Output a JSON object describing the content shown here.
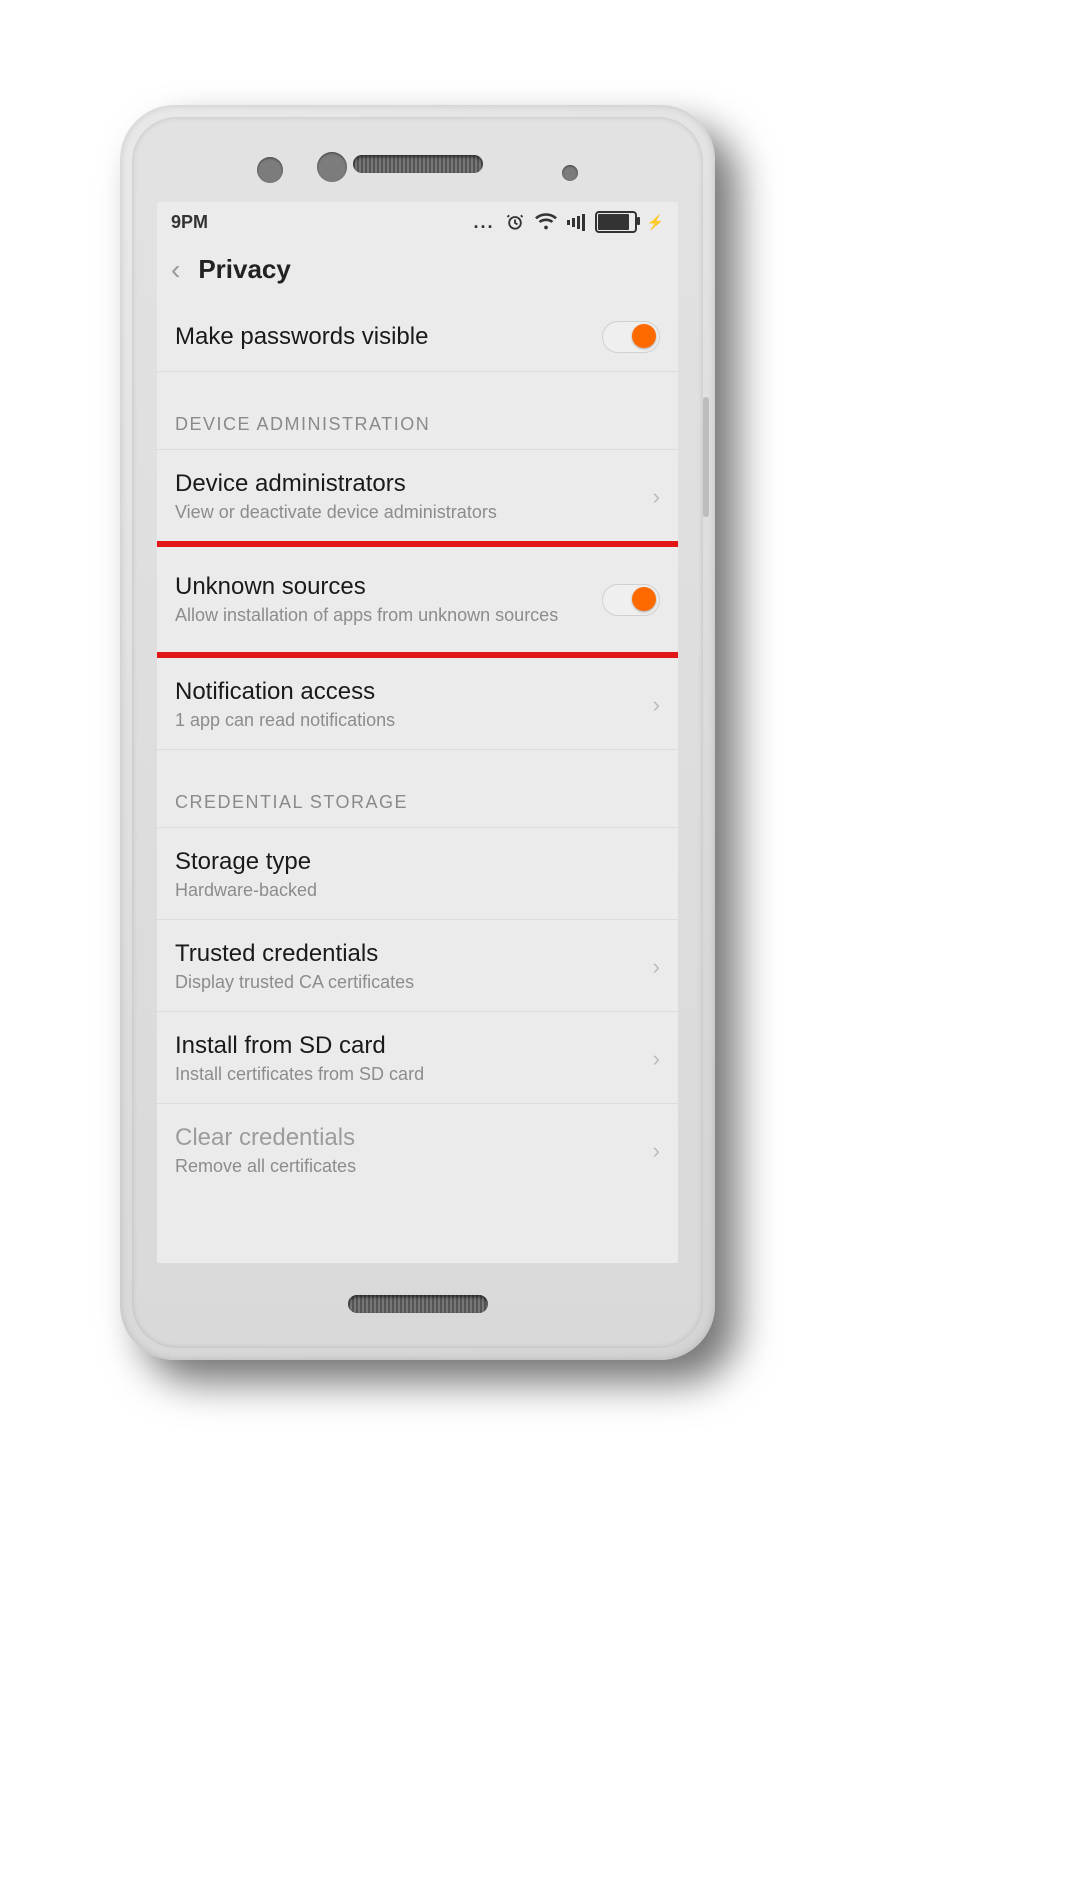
{
  "statusbar": {
    "time": "9PM",
    "dots": "..."
  },
  "titlebar": {
    "title": "Privacy"
  },
  "rows": {
    "passwords": {
      "label": "Make passwords visible",
      "toggle_on": true
    },
    "section_device": "DEVICE ADMINISTRATION",
    "device_admin": {
      "label": "Device administrators",
      "sub": "View or deactivate device administrators"
    },
    "unknown": {
      "label": "Unknown sources",
      "sub": "Allow installation of apps from unknown sources",
      "toggle_on": true
    },
    "notif": {
      "label": "Notification access",
      "sub": "1 app can read notifications"
    },
    "section_cred": "CREDENTIAL STORAGE",
    "storage": {
      "label": "Storage type",
      "sub": "Hardware-backed"
    },
    "trusted": {
      "label": "Trusted credentials",
      "sub": "Display trusted CA certificates"
    },
    "install": {
      "label": "Install from SD card",
      "sub": "Install certificates from SD card"
    },
    "clear": {
      "label": "Clear credentials",
      "sub": "Remove all certificates"
    }
  }
}
